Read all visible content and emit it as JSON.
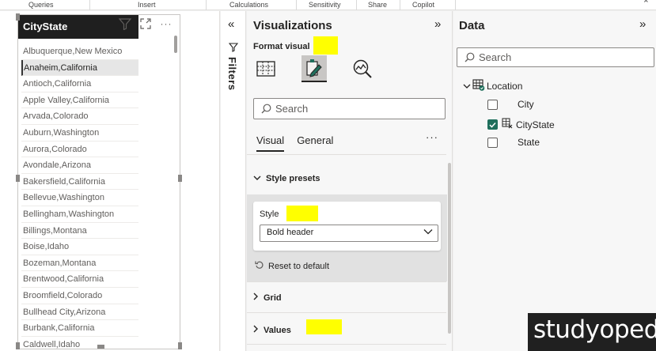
{
  "ribbon": {
    "groups": [
      "Queries",
      "Insert",
      "Calculations",
      "Sensitivity",
      "Share",
      "Copilot"
    ]
  },
  "visual": {
    "header": "CityState",
    "rows": [
      "Albuquerque,New Mexico",
      "Anaheim,California",
      "Antioch,California",
      "Apple Valley,California",
      "Arvada,Colorado",
      "Auburn,Washington",
      "Aurora,Colorado",
      "Avondale,Arizona",
      "Bakersfield,California",
      "Bellevue,Washington",
      "Bellingham,Washington",
      "Billings,Montana",
      "Boise,Idaho",
      "Bozeman,Montana",
      "Brentwood,California",
      "Broomfield,Colorado",
      "Bullhead City,Arizona",
      "Burbank,California",
      "Caldwell,Idaho"
    ],
    "selected_index": 1
  },
  "filters": {
    "label": "Filters"
  },
  "visualizations": {
    "title": "Visualizations",
    "subtitle": "Format visual",
    "search_placeholder": "Search",
    "tabs": [
      "Visual",
      "General"
    ],
    "more": "···",
    "style_presets_label": "Style presets",
    "style_label": "Style",
    "style_value": "Bold header",
    "reset_label": "Reset to default",
    "grid_label": "Grid",
    "values_label": "Values"
  },
  "data_pane": {
    "title": "Data",
    "search_placeholder": "Search",
    "table": "Location",
    "fields": [
      {
        "name": "City",
        "checked": false
      },
      {
        "name": "CityState",
        "checked": true
      },
      {
        "name": "State",
        "checked": false
      }
    ]
  },
  "watermark": "studyopedia",
  "colors": {
    "highlight": "#ffff00",
    "header_bg": "#1f1f1f",
    "check": "#1f6f5c"
  }
}
